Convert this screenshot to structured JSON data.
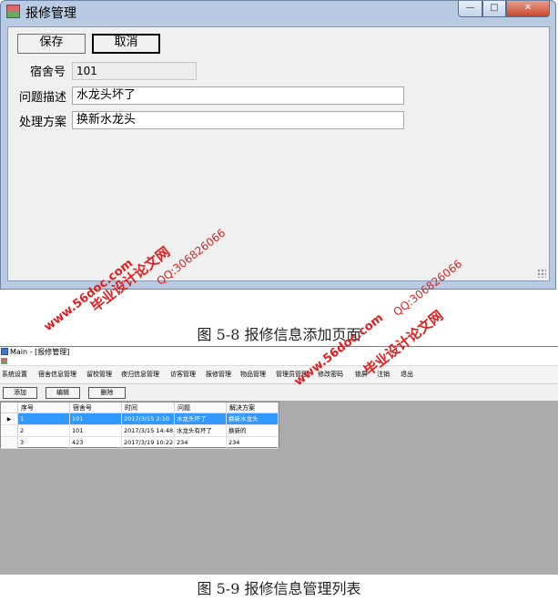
{
  "window1": {
    "title": "报修管理",
    "controls": {
      "minimize": "—",
      "maximize": "□",
      "close": "✕"
    },
    "buttons": {
      "save": "保存",
      "cancel": "取消"
    },
    "fields": {
      "dorm_label": "宿舍号",
      "dorm_value": "101",
      "problem_label": "问题描述",
      "problem_value": "水龙头坏了",
      "solution_label": "处理方案",
      "solution_value": "换新水龙头"
    }
  },
  "captions": {
    "fig1": "图 5-8 报修信息添加页面",
    "fig2": "图 5-9 报修信息管理列表"
  },
  "window2": {
    "title": "Main - [报修管理]",
    "menu": [
      "系统设置",
      "宿舍信息管理",
      "留校管理",
      "夜归信息管理",
      "访客管理",
      "报修管理",
      "物品管理",
      "管理员管理",
      "修改密码",
      "锁屏",
      "注销",
      "退出"
    ],
    "toolbar": {
      "add": "添加",
      "edit": "编辑",
      "delete": "删除"
    },
    "table": {
      "columns": [
        "序号",
        "宿舍号",
        "时间",
        "问题",
        "解决方案"
      ],
      "rows": [
        [
          "1",
          "101",
          "2017/3/15 2:10",
          "水龙头坏了",
          "换新水龙头"
        ],
        [
          "2",
          "101",
          "2017/3/15 14:48",
          "水龙头有坏了",
          "换新的"
        ],
        [
          "3",
          "423",
          "2017/3/19 10:22",
          "234",
          "234"
        ]
      ],
      "selected_row_marker": "▶"
    }
  },
  "watermarks": {
    "site": "www.56doc.com",
    "qq": "QQ:306826066",
    "name": "毕业设计论文网"
  },
  "colors": {
    "window_frame": "#b9cbe2",
    "client_bg": "#f0f0f0",
    "selection": "#3399ff",
    "watermark": "#e02020"
  }
}
